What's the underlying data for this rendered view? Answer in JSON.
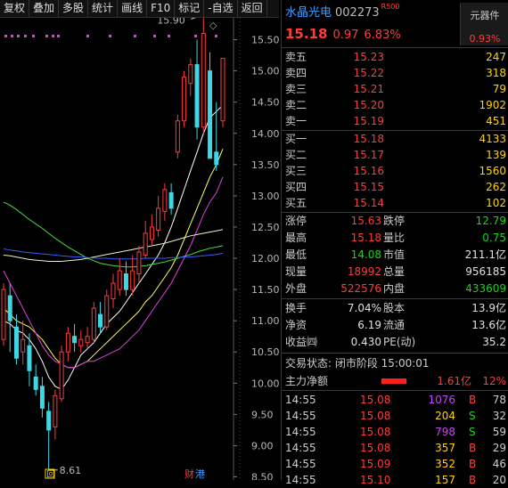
{
  "toolbar": {
    "buttons": [
      "复权",
      "叠加",
      "多股",
      "统计",
      "画线",
      "F10",
      "标记",
      "-自选",
      "返回"
    ],
    "more_label": "◇"
  },
  "chart_data": {
    "type": "candlestick",
    "y_range": [
      8.45,
      15.85
    ],
    "y_ticks": [
      "15.50",
      "15.00",
      "14.50",
      "14.00",
      "13.50",
      "13.00",
      "12.50",
      "12.00",
      "11.50",
      "11.00",
      "10.50",
      "10.00",
      "9.50",
      "9.00",
      "8.50"
    ],
    "high_label": "15.90",
    "low_label": "8.61",
    "bottom_markers": [
      "回",
      "财",
      "港"
    ],
    "candles": [
      {
        "o": 10.7,
        "c": 11.5,
        "h": 11.6,
        "l": 10.6
      },
      {
        "o": 11.4,
        "c": 11.0,
        "h": 11.6,
        "l": 10.5
      },
      {
        "o": 10.9,
        "c": 10.4,
        "h": 11.1,
        "l": 10.3
      },
      {
        "o": 10.5,
        "c": 10.7,
        "h": 11.0,
        "l": 10.3
      },
      {
        "o": 10.6,
        "c": 10.2,
        "h": 10.8,
        "l": 9.95
      },
      {
        "o": 10.1,
        "c": 9.9,
        "h": 10.3,
        "l": 9.8
      },
      {
        "o": 9.95,
        "c": 9.6,
        "h": 10.1,
        "l": 9.45
      },
      {
        "o": 9.55,
        "c": 9.25,
        "h": 9.7,
        "l": 8.61
      },
      {
        "o": 9.3,
        "c": 9.8,
        "h": 9.9,
        "l": 9.1
      },
      {
        "o": 9.75,
        "c": 10.5,
        "h": 10.6,
        "l": 9.7
      },
      {
        "o": 10.5,
        "c": 10.8,
        "h": 10.9,
        "l": 10.35
      },
      {
        "o": 10.75,
        "c": 10.65,
        "h": 10.95,
        "l": 10.5
      },
      {
        "o": 10.6,
        "c": 10.7,
        "h": 10.85,
        "l": 10.5
      },
      {
        "o": 10.65,
        "c": 10.75,
        "h": 10.9,
        "l": 10.55
      },
      {
        "o": 10.7,
        "c": 11.2,
        "h": 11.3,
        "l": 10.65
      },
      {
        "o": 11.1,
        "c": 10.9,
        "h": 11.3,
        "l": 10.8
      },
      {
        "o": 10.9,
        "c": 11.4,
        "h": 11.5,
        "l": 10.85
      },
      {
        "o": 11.35,
        "c": 11.6,
        "h": 11.75,
        "l": 11.2
      },
      {
        "o": 11.5,
        "c": 11.8,
        "h": 12.0,
        "l": 11.4
      },
      {
        "o": 11.75,
        "c": 11.5,
        "h": 11.95,
        "l": 11.4
      },
      {
        "o": 11.5,
        "c": 11.8,
        "h": 12.05,
        "l": 11.4
      },
      {
        "o": 11.75,
        "c": 12.1,
        "h": 12.2,
        "l": 11.6
      },
      {
        "o": 12.05,
        "c": 12.4,
        "h": 12.6,
        "l": 12.0
      },
      {
        "o": 12.3,
        "c": 12.5,
        "h": 12.7,
        "l": 12.2
      },
      {
        "o": 12.45,
        "c": 12.8,
        "h": 13.0,
        "l": 12.35
      },
      {
        "o": 12.75,
        "c": 13.1,
        "h": 13.2,
        "l": 12.6
      },
      {
        "o": 13.05,
        "c": 12.8,
        "h": 13.2,
        "l": 12.7
      },
      {
        "o": 13.7,
        "c": 14.2,
        "h": 14.3,
        "l": 13.6
      },
      {
        "o": 14.2,
        "c": 14.9,
        "h": 15.0,
        "l": 14.1
      },
      {
        "o": 14.8,
        "c": 15.1,
        "h": 15.2,
        "l": 14.6
      },
      {
        "o": 15.1,
        "c": 14.1,
        "h": 15.5,
        "l": 13.9
      },
      {
        "o": 14.1,
        "c": 15.6,
        "h": 15.9,
        "l": 14.0
      },
      {
        "o": 15.0,
        "c": 13.6,
        "h": 15.3,
        "l": 13.6
      },
      {
        "o": 13.7,
        "c": 13.5,
        "h": 14.5,
        "l": 13.4
      },
      {
        "o": 14.2,
        "c": 15.2,
        "h": 15.2,
        "l": 14.1
      }
    ],
    "series": [
      {
        "color": "#ffffff",
        "values": [
          11.0,
          10.95,
          10.85,
          10.8,
          10.7,
          10.55,
          10.35,
          10.1,
          9.95,
          9.9,
          10.05,
          10.25,
          10.45,
          10.55,
          10.65,
          10.8,
          10.95,
          11.05,
          11.15,
          11.3,
          11.45,
          11.6,
          11.75,
          11.9,
          12.05,
          12.25,
          12.5,
          12.8,
          13.1,
          13.4,
          13.7,
          14.0,
          14.25,
          14.35,
          14.45
        ]
      },
      {
        "color": "#ffff66",
        "values": [
          11.2,
          11.1,
          11.0,
          10.95,
          10.9,
          10.8,
          10.7,
          10.55,
          10.4,
          10.3,
          10.25,
          10.25,
          10.3,
          10.35,
          10.45,
          10.55,
          10.65,
          10.75,
          10.85,
          10.95,
          11.05,
          11.15,
          11.3,
          11.4,
          11.55,
          11.7,
          11.85,
          12.05,
          12.3,
          12.55,
          12.8,
          13.05,
          13.3,
          13.5,
          13.75
        ]
      },
      {
        "color": "#e040e0",
        "values": [
          11.8,
          11.6,
          11.4,
          11.2,
          11.0,
          10.8,
          10.6,
          10.45,
          10.35,
          10.3,
          10.25,
          10.25,
          10.3,
          10.35,
          10.35,
          10.4,
          10.45,
          10.5,
          10.55,
          10.65,
          10.75,
          10.85,
          11.0,
          11.15,
          11.3,
          11.45,
          11.6,
          11.8,
          12.0,
          12.2,
          12.45,
          12.7,
          12.9,
          13.05,
          13.3
        ]
      },
      {
        "color": "#40e040",
        "values": [
          12.9,
          12.85,
          12.78,
          12.7,
          12.62,
          12.55,
          12.48,
          12.4,
          12.32,
          12.25,
          12.18,
          12.12,
          12.06,
          12.0,
          11.96,
          11.92,
          11.9,
          11.88,
          11.87,
          11.86,
          11.86,
          11.87,
          11.88,
          11.9,
          11.92,
          11.94,
          11.97,
          12.0,
          12.03,
          12.06,
          12.1,
          12.13,
          12.16,
          12.18,
          12.2
        ]
      },
      {
        "color": "#f0f0d0",
        "values": [
          12.05,
          12.04,
          12.02,
          12.0,
          11.98,
          11.97,
          11.96,
          11.95,
          11.95,
          11.95,
          11.96,
          11.97,
          11.98,
          12.0,
          12.02,
          12.04,
          12.06,
          12.08,
          12.1,
          12.12,
          12.14,
          12.16,
          12.18,
          12.2,
          12.22,
          12.24,
          12.27,
          12.3,
          12.33,
          12.36,
          12.38,
          12.4,
          12.42,
          12.44,
          12.46
        ]
      },
      {
        "color": "#3060ff",
        "values": [
          12.15,
          12.13,
          12.12,
          12.1,
          12.09,
          12.08,
          12.07,
          12.06,
          12.05,
          12.04,
          12.03,
          12.02,
          12.02,
          12.01,
          12.0,
          12.0,
          12.0,
          11.99,
          11.99,
          11.99,
          11.99,
          11.99,
          12.0,
          12.0,
          12.0,
          12.0,
          12.01,
          12.01,
          12.02,
          12.02,
          12.03,
          12.04,
          12.05,
          12.06,
          12.08
        ]
      }
    ]
  },
  "stock": {
    "name": "水晶光电",
    "code": "002273",
    "tag": "R500",
    "price": "15.18",
    "change": "0.97",
    "change_pct": "6.83%",
    "sector": "元器件",
    "sector_pct": "0.93%"
  },
  "asks": [
    {
      "label": "卖五",
      "price": "15.23",
      "vol": "247"
    },
    {
      "label": "卖四",
      "price": "15.22",
      "vol": "318"
    },
    {
      "label": "卖三",
      "price": "15.21",
      "vol": "79"
    },
    {
      "label": "卖二",
      "price": "15.20",
      "vol": "1902"
    },
    {
      "label": "卖一",
      "price": "15.19",
      "vol": "451"
    }
  ],
  "bids": [
    {
      "label": "买一",
      "price": "15.18",
      "vol": "4133"
    },
    {
      "label": "买二",
      "price": "15.17",
      "vol": "139"
    },
    {
      "label": "买三",
      "price": "15.16",
      "vol": "1560"
    },
    {
      "label": "买四",
      "price": "15.15",
      "vol": "262"
    },
    {
      "label": "买五",
      "price": "15.14",
      "vol": "102"
    }
  ],
  "stats": [
    {
      "l1": "涨停",
      "v1": "15.63",
      "c1": "red",
      "l2": "跌停",
      "v2": "12.79",
      "c2": "green"
    },
    {
      "l1": "最高",
      "v1": "15.18",
      "c1": "red",
      "l2": "量比",
      "v2": "0.75",
      "c2": "green"
    },
    {
      "l1": "最低",
      "v1": "14.08",
      "c1": "green",
      "l2": "市值",
      "v2": "211.1亿",
      "c2": "white"
    },
    {
      "l1": "现量",
      "v1": "18992",
      "c1": "red",
      "l2": "总量",
      "v2": "956185",
      "c2": "white"
    },
    {
      "l1": "外盘",
      "v1": "522576",
      "c1": "red",
      "l2": "内盘",
      "v2": "433609",
      "c2": "green"
    }
  ],
  "fundamentals": [
    {
      "l1": "换手",
      "v1": "7.04%",
      "l2": "股本",
      "v2": "13.9亿"
    },
    {
      "l1": "净资",
      "v1": "6.19",
      "l2": "流通",
      "v2": "13.6亿"
    },
    {
      "l1": "收益㈣",
      "v1": "0.430",
      "l2": "PE(动)",
      "v2": "35.2"
    }
  ],
  "trade_status": "交易状态: 闭市阶段 15:00:01",
  "flow": {
    "label": "主力净额",
    "value": "1.61亿",
    "pct": "12%"
  },
  "ticks": [
    {
      "time": "14:55",
      "price": "15.08",
      "vol": "1076",
      "vc": "purple",
      "bs": "B",
      "bc": "red",
      "cnt": "78"
    },
    {
      "time": "14:55",
      "price": "15.08",
      "vol": "204",
      "vc": "yellow",
      "bs": "S",
      "bc": "green",
      "cnt": "32"
    },
    {
      "time": "14:55",
      "price": "15.08",
      "vol": "798",
      "vc": "purple",
      "bs": "S",
      "bc": "green",
      "cnt": "59"
    },
    {
      "time": "14:55",
      "price": "15.08",
      "vol": "357",
      "vc": "yellow",
      "bs": "B",
      "bc": "red",
      "cnt": "29"
    },
    {
      "time": "14:55",
      "price": "15.09",
      "vol": "352",
      "vc": "yellow",
      "bs": "B",
      "bc": "red",
      "cnt": "46"
    },
    {
      "time": "14:55",
      "price": "15.10",
      "vol": "157",
      "vc": "yellow",
      "bs": "B",
      "bc": "red",
      "cnt": "20"
    }
  ]
}
